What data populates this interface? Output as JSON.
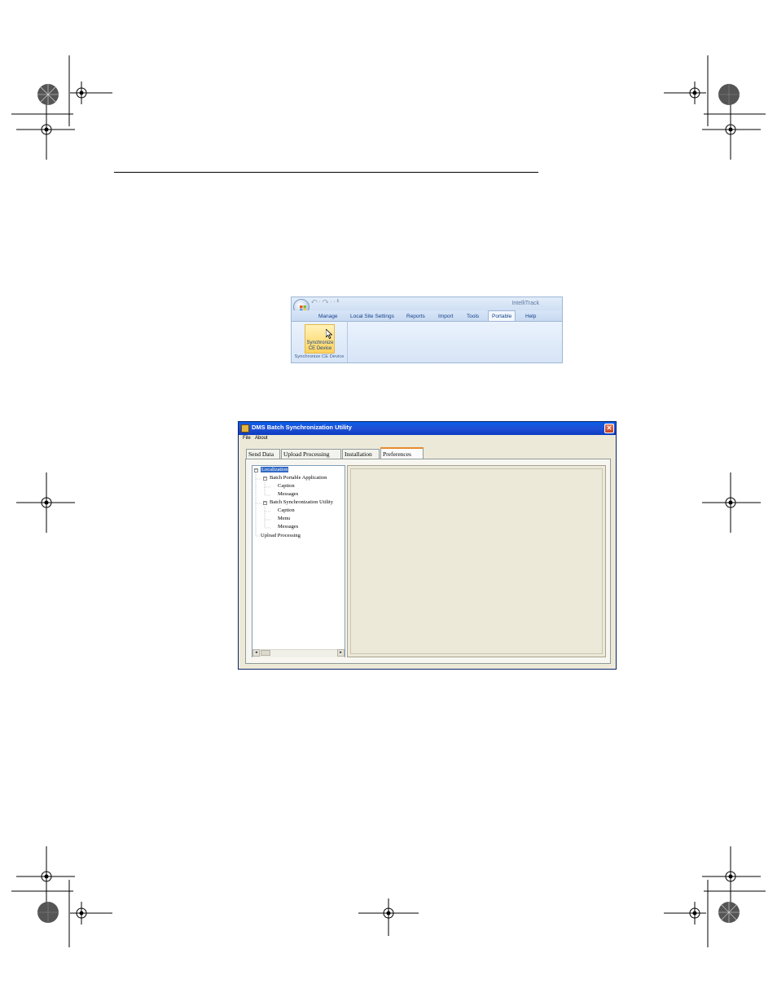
{
  "ribbon": {
    "app_title": "IntelliTrack",
    "qat": "↶ · ↷ · · ⱛ",
    "tabs": [
      "Manage",
      "Local Site Settings",
      "Reports",
      "Import",
      "Tools",
      "Portable",
      "Help"
    ],
    "active_tab": "Portable",
    "button_label_line1": "Synchronize",
    "button_label_line2": "CE Device",
    "group_label": "Synchronize CE Device"
  },
  "window": {
    "title": "DMS Batch Synchronization Utility",
    "close_label": "✕",
    "menu": [
      "File",
      "About"
    ],
    "tabs": [
      "Send Data",
      "Upload Processing",
      "Installation",
      "Preferences"
    ],
    "active_tab": "Preferences",
    "tree": {
      "root": "Localization",
      "portable": "Batch Portable Application",
      "portable_caption": "Caption",
      "portable_messages": "Messages",
      "utility": "Batch Synchronization Utility",
      "utility_caption": "Caption",
      "utility_menu": "Menu",
      "utility_messages": "Messages",
      "upload": "Upload Processing"
    },
    "scroll_left": "◂",
    "scroll_right": "▸"
  },
  "colors": {
    "ribbon_accent": "#15428b",
    "xp_title": "#0a5fe8",
    "selection": "#316ac5"
  }
}
